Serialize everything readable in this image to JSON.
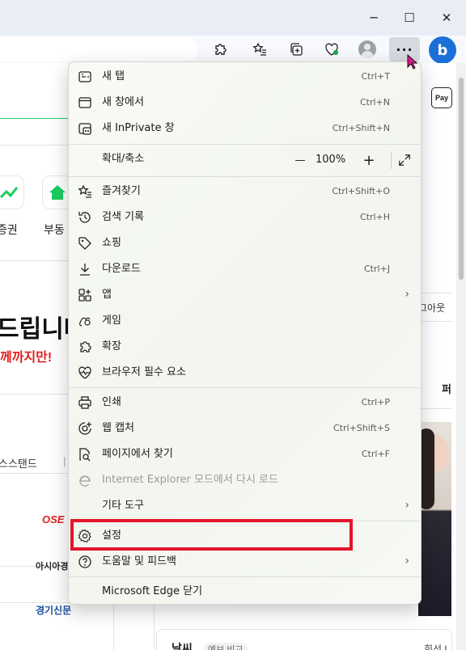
{
  "window": {
    "minimize_glyph": "─",
    "maximize_glyph": "☐",
    "close_glyph": "✕"
  },
  "toolbar": {
    "more_label": "···",
    "copilot_label": "b"
  },
  "page": {
    "card1_label": "증권",
    "card2_label": "부동",
    "headline": "드립니다",
    "subheadline": "께까지만!",
    "newsstand": "스스탠드",
    "newsstand_sep": "|",
    "logo1": "OSE",
    "logo2": "아시아경",
    "logo3": "경기신문",
    "right_text1": "그아웃",
    "right_text2": "퍼",
    "bottom_text": "날씨",
    "bottom_badge": "예보 비교",
    "bottom_right": "회선 L",
    "pay_label": "Pay"
  },
  "menu": {
    "new_tab": {
      "label": "새 탭",
      "shortcut": "Ctrl+T"
    },
    "new_window": {
      "label": "새 창에서",
      "shortcut": "Ctrl+N"
    },
    "new_inprivate": {
      "label": "새 InPrivate 창",
      "shortcut": "Ctrl+Shift+N"
    },
    "zoom": {
      "label": "확대/축소",
      "minus": "—",
      "value": "100%",
      "plus": "+"
    },
    "favorites": {
      "label": "즐겨찾기",
      "shortcut": "Ctrl+Shift+O"
    },
    "history": {
      "label": "검색 기록",
      "shortcut": "Ctrl+H"
    },
    "shopping": {
      "label": "쇼핑"
    },
    "downloads": {
      "label": "다운로드",
      "shortcut": "Ctrl+J"
    },
    "apps": {
      "label": "앱"
    },
    "games": {
      "label": "게임"
    },
    "extensions": {
      "label": "확장"
    },
    "essentials": {
      "label": "브라우저 필수 요소"
    },
    "print": {
      "label": "인쇄",
      "shortcut": "Ctrl+P"
    },
    "web_capture": {
      "label": "웹 캡처",
      "shortcut": "Ctrl+Shift+S"
    },
    "find": {
      "label": "페이지에서 찾기",
      "shortcut": "Ctrl+F"
    },
    "ie_mode": {
      "label": "Internet Explorer 모드에서 다시 로드"
    },
    "more_tools": {
      "label": "기타 도구"
    },
    "settings": {
      "label": "설정"
    },
    "help": {
      "label": "도움말 및 피드백"
    },
    "close_edge": {
      "label": "Microsoft Edge 닫기"
    },
    "chevron": "›"
  },
  "colors": {
    "highlight": "#e3162b",
    "naver_green": "#19ce60",
    "copilot_blue": "#1b6fd8"
  }
}
